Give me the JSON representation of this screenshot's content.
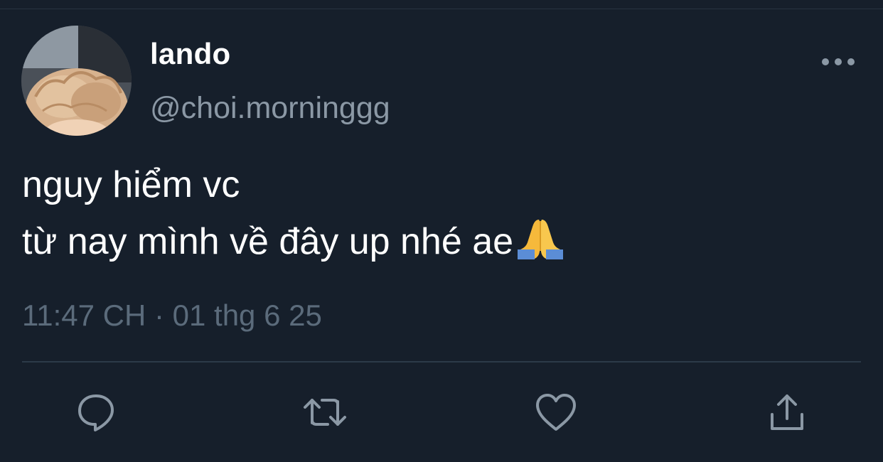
{
  "tweet": {
    "author_name": "lando",
    "author_handle": "@choi.morninggg",
    "body_lines": [
      "nguy hiểm vc",
      "từ nay mình về đây up nhé ae"
    ],
    "emoji": "folded-hands",
    "timestamp": "11:47 CH · 01 thg 6 25"
  },
  "actions": {
    "reply_icon": "speech-bubble-icon",
    "retweet_icon": "retweet-icon",
    "like_icon": "heart-icon",
    "share_icon": "share-upload-icon"
  },
  "colors": {
    "background": "#161f2b",
    "primary_text": "#ffffff",
    "secondary_text": "#8b98a5",
    "muted_text": "#5b6b7b",
    "divider": "#2c3a48"
  }
}
